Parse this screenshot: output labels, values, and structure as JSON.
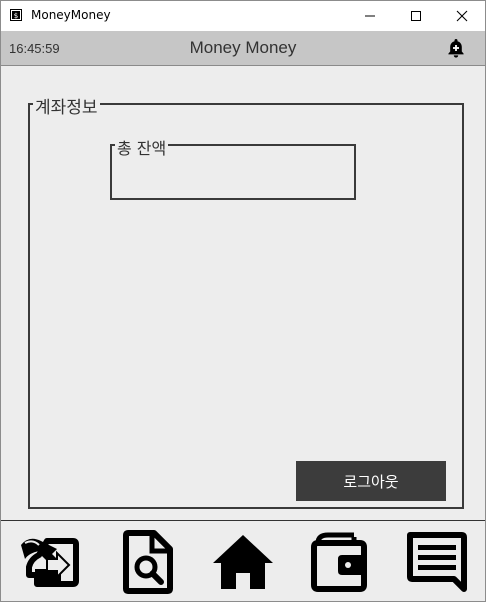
{
  "window": {
    "title": "MoneyMoney",
    "controls": [
      "minimize",
      "maximize",
      "close"
    ]
  },
  "header": {
    "time": "16:45:59",
    "title": "Money Money",
    "notification_icon": "bell-plus-icon"
  },
  "account": {
    "group_label": "계좌정보",
    "balance_label": "총 잔액",
    "balance_value": ""
  },
  "buttons": {
    "logout_label": "로그아웃"
  },
  "nav": {
    "items": [
      {
        "icon": "transfer-icon"
      },
      {
        "icon": "search-document-icon"
      },
      {
        "icon": "home-icon"
      },
      {
        "icon": "wallet-icon"
      },
      {
        "icon": "message-icon"
      }
    ]
  },
  "colors": {
    "background": "#ededed",
    "header": "#c6c6c6",
    "button": "#3c3c3c",
    "border": "#3a3a3a"
  }
}
